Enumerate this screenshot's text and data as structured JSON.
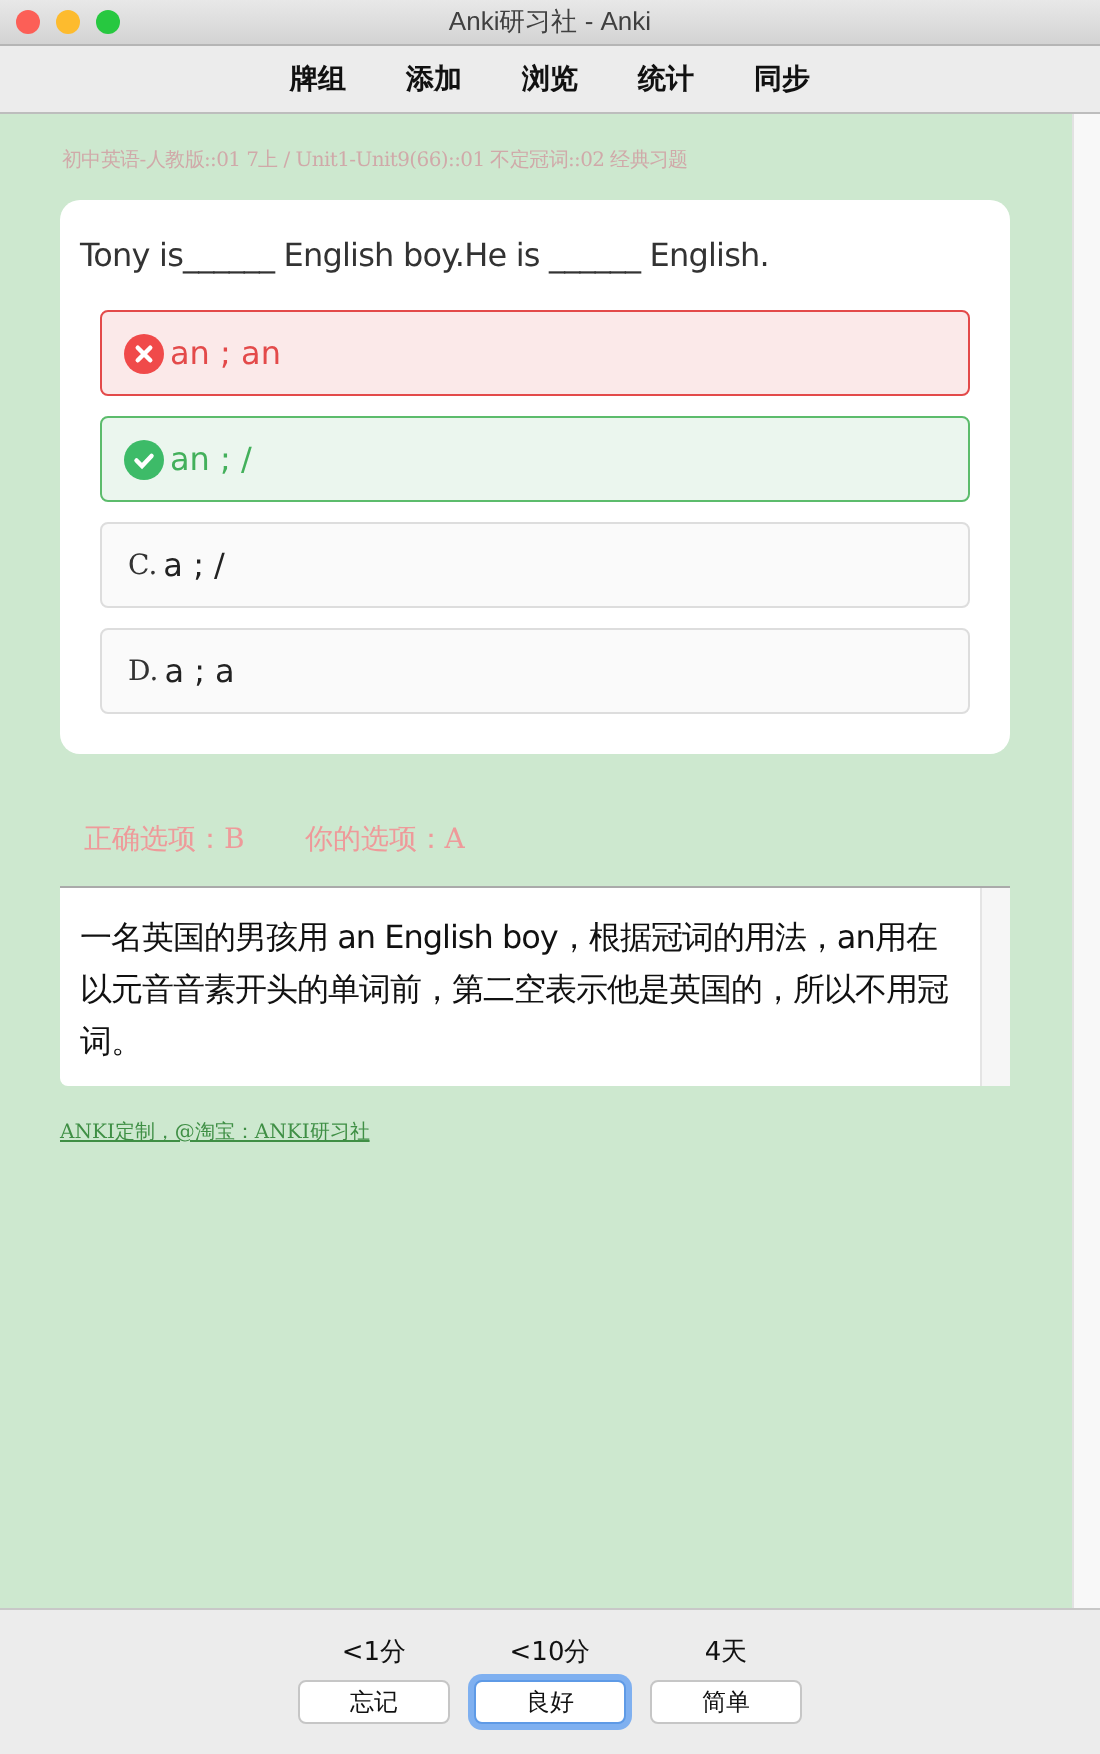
{
  "window": {
    "title": "Anki研习社 - Anki"
  },
  "toolbar": [
    "牌组",
    "添加",
    "浏览",
    "统计",
    "同步"
  ],
  "deck_path": "初中英语-人教版::01 7上 / Unit1-Unit9(66)::01 不定冠词::02 经典习题",
  "question": "Tony is______ English boy.He is ______ English.",
  "options": [
    {
      "kind": "wrong",
      "text": "an ; an"
    },
    {
      "kind": "correct",
      "text": "an ; /"
    },
    {
      "kind": "plain",
      "label": "C.",
      "text": "a ; /"
    },
    {
      "kind": "plain",
      "label": "D.",
      "text": "a ; a"
    }
  ],
  "result": {
    "correct": "正确选项：B",
    "yours": "你的选项：A"
  },
  "explanation": "一名英国的男孩用 an English boy，根据冠词的用法，an用在以元音音素开头的单词前，第二空表示他是英国的，所以不用冠词。",
  "footer_link": "ANKI定制，@淘宝：ANKI研习社",
  "answers": [
    {
      "interval": "<1分",
      "label": "忘记",
      "selected": false
    },
    {
      "interval": "<10分",
      "label": "良好",
      "selected": true
    },
    {
      "interval": "4天",
      "label": "简单",
      "selected": false
    }
  ]
}
